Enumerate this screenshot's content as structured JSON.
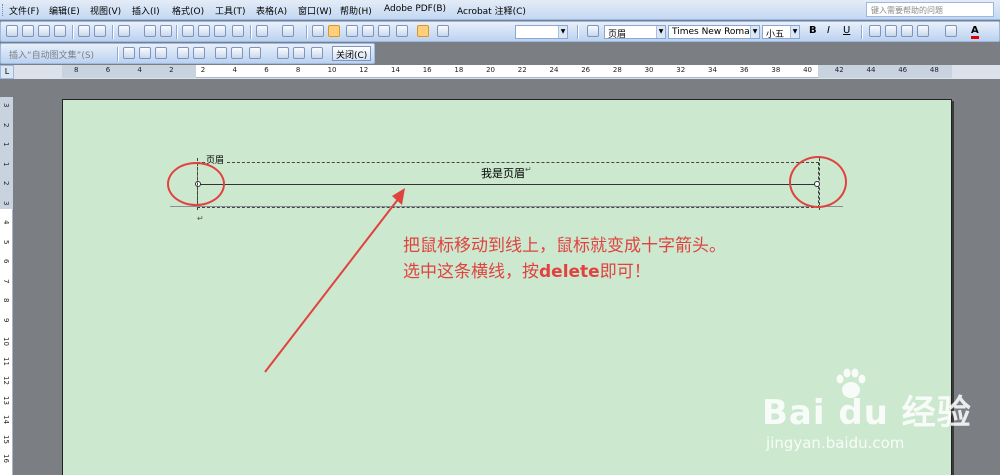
{
  "menubar": {
    "items": [
      "文件(F)",
      "编辑(E)",
      "视图(V)",
      "插入(I)",
      "格式(O)",
      "工具(T)",
      "表格(A)",
      "窗口(W)",
      "帮助(H)",
      "Adobe PDF(B)",
      "Acrobat 注释(C)"
    ],
    "help_placeholder": "键入需要帮助的问题"
  },
  "format_toolbar": {
    "style": "页眉",
    "font": "Times New Roman",
    "size": "小五",
    "bold": "B",
    "italic": "I",
    "underline": "U",
    "font_color": "A"
  },
  "header_footer_toolbar": {
    "insert_autotext": "插入“自动图文集”(S)",
    "close": "关闭(C)"
  },
  "ruler": {
    "corner": "L",
    "h_numbers": [
      "8",
      "6",
      "4",
      "2",
      "2",
      "4",
      "6",
      "8",
      "10",
      "12",
      "14",
      "16",
      "18",
      "20",
      "22",
      "24",
      "26",
      "28",
      "30",
      "32",
      "34",
      "36",
      "38",
      "40",
      "42",
      "44",
      "46",
      "48"
    ],
    "v_numbers": [
      "3",
      "2",
      "1",
      "1",
      "2",
      "3",
      "4",
      "5",
      "6",
      "7",
      "8",
      "9",
      "10",
      "11",
      "12",
      "13",
      "14",
      "15",
      "16"
    ]
  },
  "document": {
    "header_tag": "页眉",
    "header_text": "我是页眉",
    "para_mark": "↵",
    "annotation_line1": "把鼠标移动到线上，鼠标就变成十字箭头。",
    "annotation_line2_pre": "选中这条横线，按",
    "annotation_line2_key": "delete",
    "annotation_line2_post": "即可！"
  },
  "watermark": {
    "logo": "Bai du 经验",
    "url": "jingyan.baidu.com"
  },
  "colors": {
    "annotation": "#e0433f",
    "page_background": "#cce8cf",
    "workspace": "#7b7f84",
    "toolbar": "#c4d8f2"
  }
}
